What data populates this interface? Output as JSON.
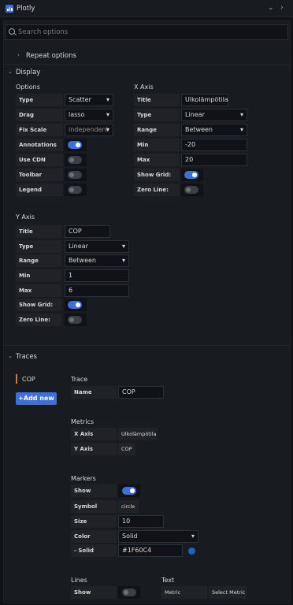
{
  "header": {
    "title": "Plotly",
    "collapse_icon": "chevron-down-icon",
    "expand_icon": "chevron-right-icon"
  },
  "search": {
    "placeholder": "Search options"
  },
  "repeat": {
    "label": "Repeat options"
  },
  "display": {
    "title": "Display",
    "options": {
      "title": "Options",
      "type": {
        "label": "Type",
        "value": "Scatter"
      },
      "drag": {
        "label": "Drag",
        "value": "lasso"
      },
      "fix_scale": {
        "label": "Fix Scale",
        "value": "independent"
      },
      "annotations": {
        "label": "Annotations",
        "on": true
      },
      "use_cdn": {
        "label": "Use CDN",
        "on": false
      },
      "toolbar": {
        "label": "Toolbar",
        "on": false
      },
      "legend": {
        "label": "Legend",
        "on": false
      }
    },
    "x_axis": {
      "title": "X Axis",
      "title_field": {
        "label": "Title",
        "value": "Ulkolämpötila"
      },
      "type": {
        "label": "Type",
        "value": "Linear"
      },
      "range": {
        "label": "Range",
        "value": "Between"
      },
      "min": {
        "label": "Min",
        "value": "-20"
      },
      "max": {
        "label": "Max",
        "value": "20"
      },
      "show_grid": {
        "label": "Show Grid:",
        "on": true
      },
      "zero_line": {
        "label": "Zero Line:",
        "on": false
      }
    },
    "y_axis": {
      "title": "Y Axis",
      "title_field": {
        "label": "Title",
        "value": "COP"
      },
      "type": {
        "label": "Type",
        "value": "Linear"
      },
      "range": {
        "label": "Range",
        "value": "Between"
      },
      "min": {
        "label": "Min",
        "value": "1"
      },
      "max": {
        "label": "Max",
        "value": "6"
      },
      "show_grid": {
        "label": "Show Grid:",
        "on": true
      },
      "zero_line": {
        "label": "Zero Line:",
        "on": false
      }
    }
  },
  "traces": {
    "title": "Traces",
    "list": [
      {
        "name": "COP"
      }
    ],
    "add_label": "+Add new",
    "trace": {
      "title": "Trace",
      "name_label": "Name",
      "name_value": "COP"
    },
    "metrics": {
      "title": "Metrics",
      "x_label": "X Axis",
      "x_value": "Ulkolämpötila",
      "y_label": "Y Axis",
      "y_value": "COP"
    },
    "markers": {
      "title": "Markers",
      "show_label": "Show",
      "show_on": true,
      "symbol_label": "Symbol",
      "symbol_value": "circle",
      "size_label": "Size",
      "size_value": "10",
      "color_label": "Color",
      "color_value": "Solid",
      "solid_label": "- Solid",
      "solid_value": "#1F60C4",
      "swatch_color": "#1F60C4"
    },
    "lines": {
      "title": "Lines",
      "show_label": "Show",
      "show_on": false
    },
    "text": {
      "title": "Text",
      "metric_label": "Metric",
      "metric_value": "Select Metric"
    }
  },
  "colors": {
    "accent": "#3d71d9",
    "trace_marker": "#e0752d"
  }
}
